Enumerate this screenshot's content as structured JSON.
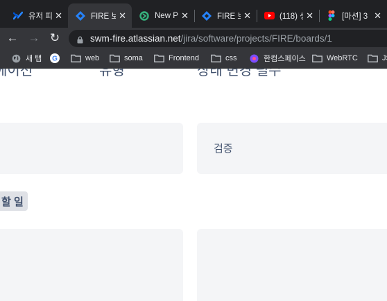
{
  "tabs": [
    {
      "title": "유저 피",
      "icon": "confluence-icon",
      "active": false
    },
    {
      "title": "FIRE 보",
      "icon": "jira-icon",
      "active": true
    },
    {
      "title": "New P",
      "icon": "new-page-icon",
      "active": false
    },
    {
      "title": "FIRE 보",
      "icon": "jira-icon",
      "active": false
    },
    {
      "title": "(118) 생",
      "icon": "youtube-icon",
      "active": false
    },
    {
      "title": "[마션] 3",
      "icon": "figma-icon",
      "active": false
    }
  ],
  "toolbar": {
    "back_icon": "←",
    "forward_icon": "→",
    "reload_icon": "↻",
    "url_host": "swm-fire.atlassian.net",
    "url_path": "/jira/software/projects/FIRE/boards/1"
  },
  "bookmarks": [
    {
      "label": "새 탭",
      "icon": "globe-icon"
    },
    {
      "label": "",
      "icon": "google-icon"
    },
    {
      "label": "web",
      "icon": "folder-icon"
    },
    {
      "label": "soma",
      "icon": "folder-icon"
    },
    {
      "label": "Frontend",
      "icon": "folder-icon"
    },
    {
      "label": "css",
      "icon": "folder-icon"
    },
    {
      "label": "한컴스페이스",
      "icon": "hancom-icon"
    },
    {
      "label": "WebRTC",
      "icon": "folder-icon"
    },
    {
      "label": "JS",
      "icon": "folder-icon"
    }
  ],
  "board": {
    "column_headers": [
      "에이전",
      "유형",
      "상태 변경 필수"
    ],
    "review_column_title": "검증",
    "swimlane_label": "할 일"
  },
  "colors": {
    "tabbar_bg": "#202124",
    "toolbar_bg": "#35363a",
    "card_bg": "#f4f5f7",
    "text": "#42526e",
    "jira_blue": "#2684ff"
  }
}
